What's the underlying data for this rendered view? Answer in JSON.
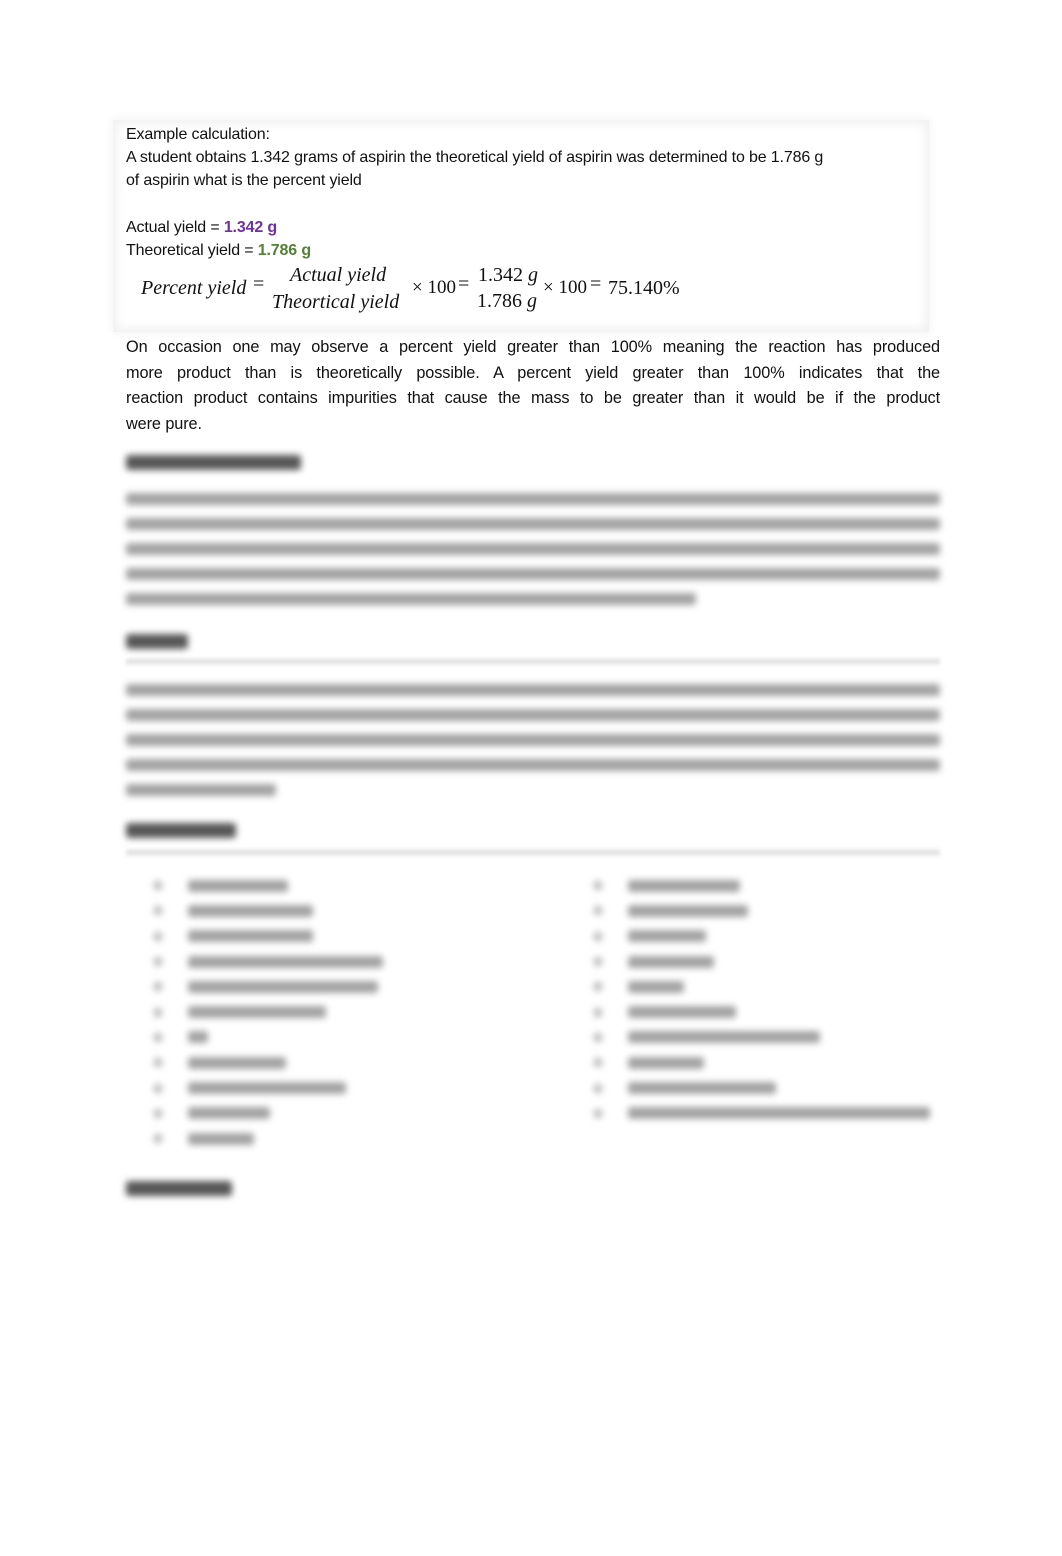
{
  "example": {
    "heading": "Example calculation:",
    "problem_line1": "A student obtains 1.342 grams of aspirin the theoretical yield of aspirin was determined to be 1.786 g",
    "problem_line2": "of aspirin what is the percent yield",
    "actual_label": "Actual yield = ",
    "actual_value": "1.342 g",
    "theoretical_label": "Theoretical yield = ",
    "theoretical_value": "1.786 g",
    "colors": {
      "actual": "#7030a0",
      "theoretical": "#538135"
    },
    "equation": {
      "lhs": "Percent yield",
      "equals": "=",
      "numerator": "Actual yield",
      "denominator": "Theortical yield",
      "times100": "× 100",
      "num_value": "1.342",
      "den_value": "1.786",
      "unit": "g",
      "result": "75.140%"
    }
  },
  "paragraph": {
    "line1": "On occasion one may observe a percent yield greater than 100% meaning the reaction has produced",
    "line2": "more product than is theoretically possible.  A percent yield greater than 100% indicates that the",
    "line3": "reaction product contains impurities that cause the mass to be greater than it would be if the product",
    "line4": "were pure."
  },
  "obscured_sections": [
    {
      "section": "melting-point-section",
      "state": "blurred"
    },
    {
      "section": "safety-section",
      "state": "blurred"
    },
    {
      "section": "equipment-section",
      "state": "blurred",
      "left_items": 11,
      "right_items": 10
    },
    {
      "section": "next-section-heading",
      "state": "blurred"
    }
  ]
}
